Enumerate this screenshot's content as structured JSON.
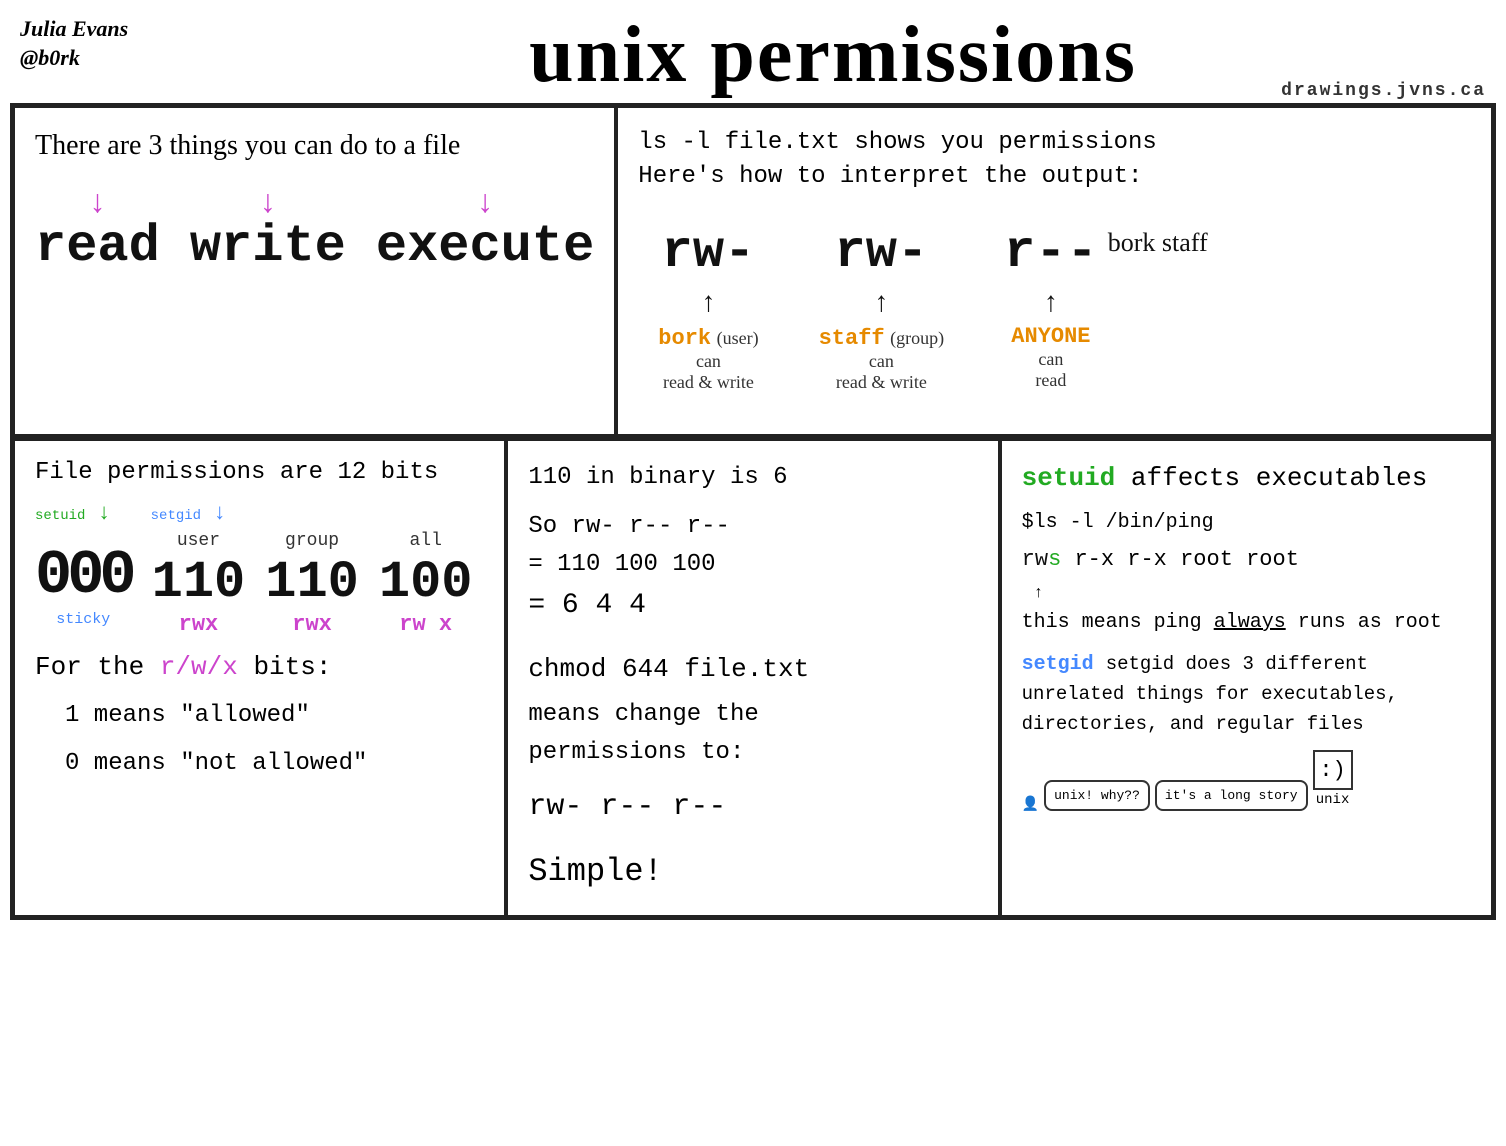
{
  "header": {
    "author": "Julia Evans",
    "handle": "@b0rk",
    "title": "unix permissions",
    "url": "drawings.jvns.ca"
  },
  "topLeft": {
    "intro": "There are 3 things you can do to a file",
    "items": [
      "read",
      "write",
      "execute"
    ]
  },
  "topRight": {
    "intro_line1": "ls -l file.txt shows you permissions",
    "intro_line2": "Here's how to interpret the output:",
    "perms": [
      "rw-",
      "rw-",
      "r--"
    ],
    "labels": [
      "bork (user)",
      "staff (group)",
      "ANYONE"
    ],
    "sublabels": [
      "can",
      "can",
      "can"
    ],
    "actions": [
      "read & write",
      "read & write",
      "read"
    ],
    "file_owner": "bork staff"
  },
  "bottomLeft": {
    "title": "File permissions are 12 bits",
    "setuid": "setuid",
    "setgid": "setgid",
    "sticky": "sticky",
    "ooo": "000",
    "col_user_label": "user",
    "col_group_label": "group",
    "col_all_label": "all",
    "col_user_num": "110",
    "col_group_num": "110",
    "col_all_num": "100",
    "col_user_rwx": "rwx",
    "col_group_rwx": "rwx",
    "col_all_rwx": "rw x",
    "for_rwx": "For the r/w/x bits:",
    "one_means": "1 means \"allowed\"",
    "zero_means": "0 means \"not allowed\""
  },
  "bottomMid": {
    "binary_title": "110 in binary is 6",
    "line1": "So rw-  r--   r--",
    "line2": "  = 110  100  100",
    "line3": "  =  6    4    4",
    "chmod_title": "chmod  644 file.txt",
    "chmod_sub1": "means change the",
    "chmod_sub2": "permissions to:",
    "result": "rw-  r--  r--",
    "simple": "Simple!"
  },
  "bottomRight": {
    "setuid_title": "setuid affects executables",
    "cmd": "$ls -l /bin/ping",
    "rws_line": "rws r-x  r-x  root root",
    "s_note": "this means ping always runs as root",
    "setgid_text": "setgid does 3 different unrelated things for executables, directories, and regular files",
    "comic1": "unix! why??",
    "comic2": "it's a long story",
    "comic3": "unix"
  }
}
